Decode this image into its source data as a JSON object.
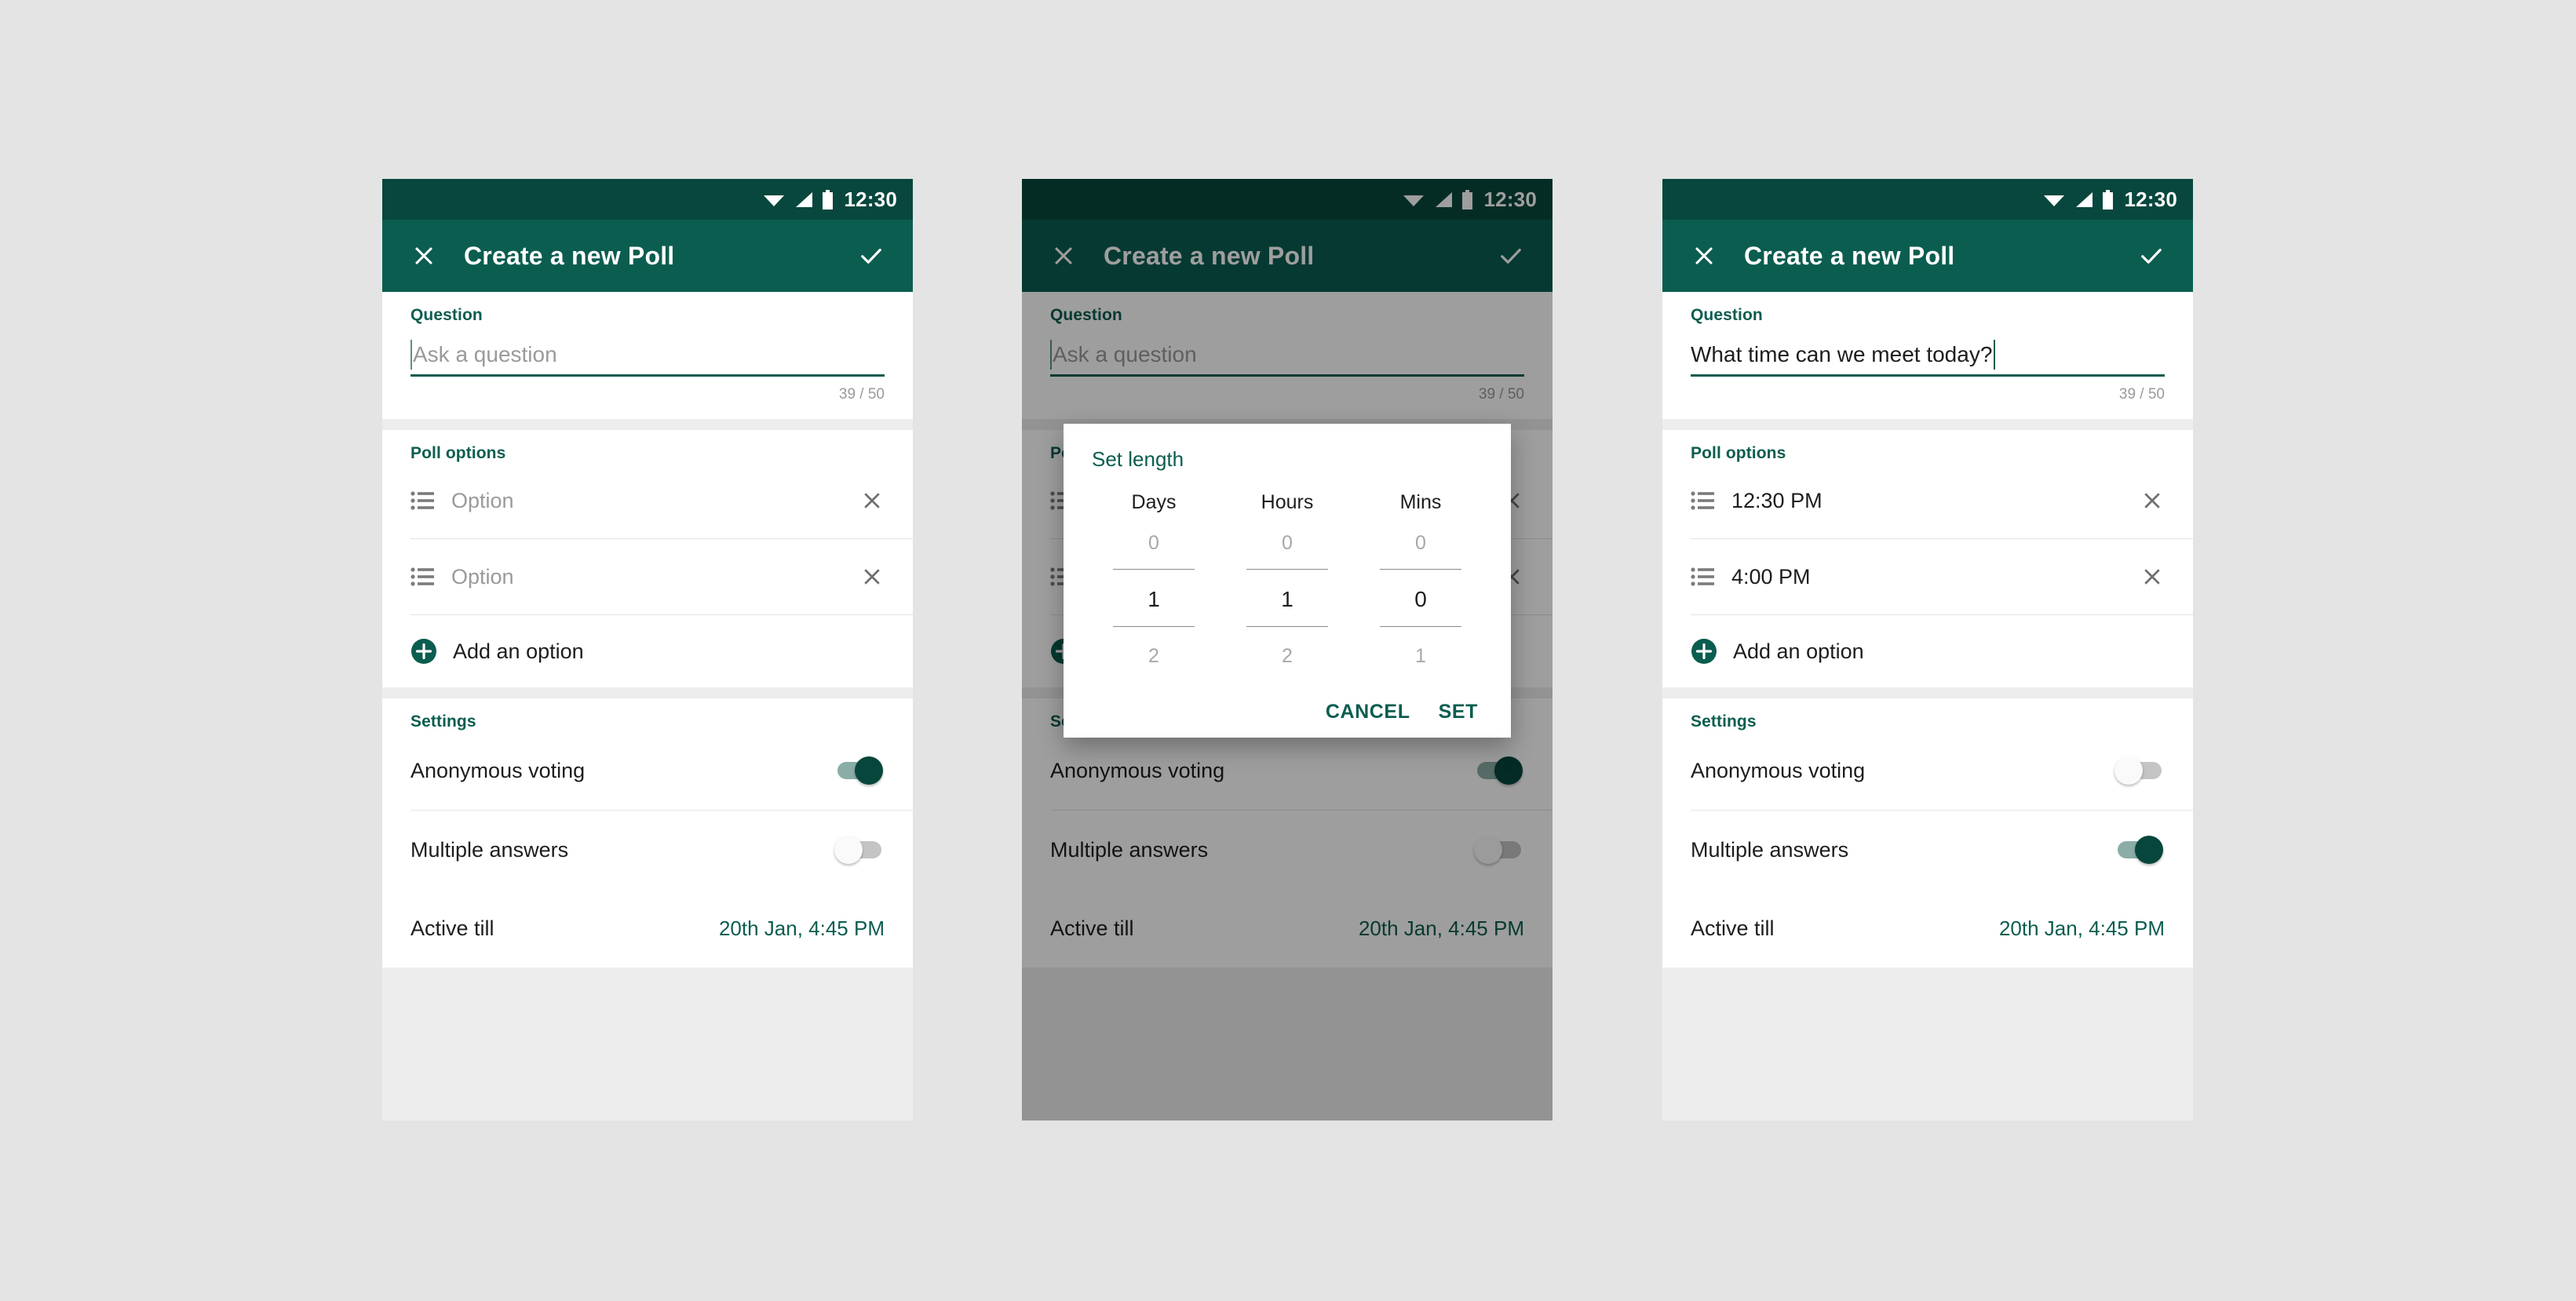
{
  "statusbar": {
    "time": "12:30",
    "icons": [
      "wifi-icon",
      "signal-icon",
      "battery-icon"
    ]
  },
  "toolbar": {
    "title": "Create a new Poll",
    "close_icon": "close-icon",
    "confirm_icon": "check-icon"
  },
  "colors": {
    "primary": "#0b5d4f",
    "status_bar": "#08473d",
    "toggle_on_track": "#8bada7",
    "toggle_on_thumb": "#07463c",
    "toggle_off_track": "#c4c4c4",
    "page_background": "#e4e4e4",
    "card_background": "#ffffff",
    "panel_background": "#ededed"
  },
  "question": {
    "label": "Question",
    "placeholder": "Ask a question",
    "value_filled": "What time can we meet today?",
    "counter": "39 / 50"
  },
  "poll_options": {
    "label": "Poll options",
    "placeholder": "Option",
    "empty_rows": [
      "Option",
      "Option"
    ],
    "filled_rows": [
      "12:30 PM",
      "4:00 PM"
    ],
    "add_label": "Add an option",
    "add_icon": "plus-circle-icon",
    "reorder_icon": "reorder-list-icon",
    "remove_icon": "close-icon"
  },
  "settings": {
    "label": "Settings",
    "anonymous_label": "Anonymous voting",
    "multiple_label": "Multiple answers",
    "active_till_label": "Active till",
    "active_till_value": "20th Jan, 4:45 PM",
    "panel1": {
      "anonymous_on": "on",
      "multiple_on": "off"
    },
    "panel3": {
      "anonymous_on": "off",
      "multiple_on": "on"
    }
  },
  "dialog": {
    "title": "Set length",
    "columns": [
      {
        "header": "Days",
        "prev": "0",
        "current": "1",
        "next": "2"
      },
      {
        "header": "Hours",
        "prev": "0",
        "current": "1",
        "next": "2"
      },
      {
        "header": "Mins",
        "prev": "0",
        "current": "0",
        "next": "1"
      }
    ],
    "cancel_label": "CANCEL",
    "set_label": "SET"
  }
}
